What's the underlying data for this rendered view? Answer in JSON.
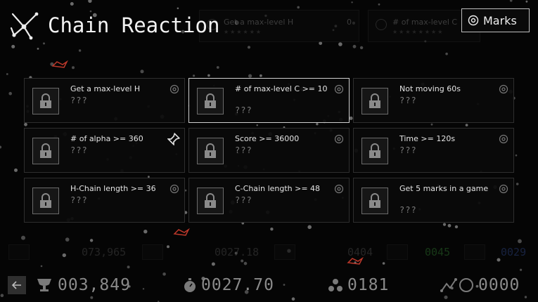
{
  "header": {
    "title": "Chain Reaction",
    "logo_icon": "chain-molecule-icon",
    "marks_button": {
      "label": "Marks",
      "icon": "target-icon"
    }
  },
  "background_banners": [
    {
      "title": "Get a max-level H",
      "value": "0",
      "stars": "★★★★★★"
    },
    {
      "title": "# of max-level C",
      "stars": "★★★★★★★★"
    }
  ],
  "achievements": [
    {
      "name": "Get a max-level H",
      "progress": "???",
      "icon": "lock-icon",
      "corner_icon": "target-icon",
      "selected": false
    },
    {
      "name": "# of max-level C >= 10",
      "progress": "???",
      "icon": "lock-icon",
      "corner_icon": "target-icon",
      "selected": true
    },
    {
      "name": "Not moving 60s",
      "progress": "???",
      "icon": "lock-icon",
      "corner_icon": "target-icon",
      "selected": false
    },
    {
      "name": "# of alpha >= 360",
      "progress": "???",
      "icon": "lock-icon",
      "corner_icon": "pin-icon",
      "selected": false
    },
    {
      "name": "Score >= 36000",
      "progress": "???",
      "icon": "lock-icon",
      "corner_icon": "target-icon",
      "selected": false
    },
    {
      "name": "Time >= 120s",
      "progress": "???",
      "icon": "lock-icon",
      "corner_icon": "target-icon",
      "selected": false
    },
    {
      "name": "H-Chain length >= 36",
      "progress": "???",
      "icon": "lock-icon",
      "corner_icon": "target-icon",
      "selected": false
    },
    {
      "name": "C-Chain length >= 48",
      "progress": "???",
      "icon": "lock-icon",
      "corner_icon": "target-icon",
      "selected": false
    },
    {
      "name": "Get 5 marks in a game",
      "progress": "???",
      "icon": "lock-icon",
      "corner_icon": "target-icon",
      "selected": false
    }
  ],
  "ghost_hud": [
    "073,965",
    "0027.18",
    "0404",
    "0045",
    "0029"
  ],
  "bottom_bar": {
    "back_icon": "back-arrow-icon",
    "score": {
      "icon": "trophy-icon",
      "value": "003,849"
    },
    "time": {
      "icon": "stopwatch-icon",
      "value": "0027.70"
    },
    "particles": {
      "icon": "particles-icon",
      "value": "0181"
    },
    "chain": {
      "icon": "chain-icon",
      "value": "0000"
    }
  },
  "colors": {
    "background": "#050505",
    "text": "#e8e8e8",
    "dim_text": "#8a8a8a",
    "accent_red": "#c0392b"
  }
}
